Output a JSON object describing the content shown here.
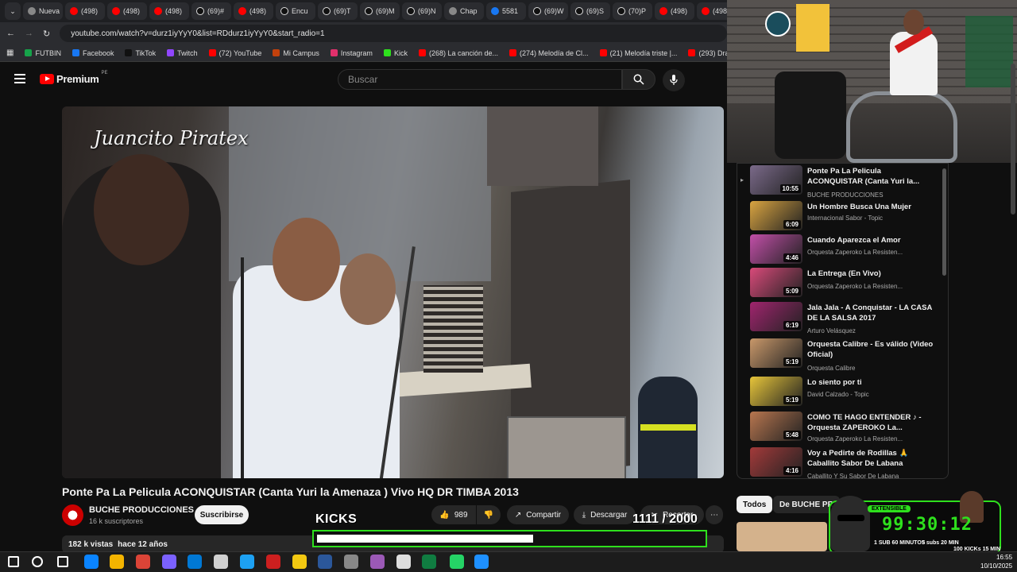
{
  "browser": {
    "tabs": [
      {
        "label": "Nueva",
        "icon": "gl"
      },
      {
        "label": "(498)",
        "icon": "yt"
      },
      {
        "label": "(498)",
        "icon": "yt"
      },
      {
        "label": "(498)",
        "icon": "yt"
      },
      {
        "label": "(69)#",
        "icon": "tk"
      },
      {
        "label": "(498)",
        "icon": "yt"
      },
      {
        "label": "Encu",
        "icon": "tk"
      },
      {
        "label": "(69)T",
        "icon": "tk"
      },
      {
        "label": "(69)M",
        "icon": "tk"
      },
      {
        "label": "(69)N",
        "icon": "tk"
      },
      {
        "label": "Chap",
        "icon": "gl"
      },
      {
        "label": "5581",
        "icon": "fb"
      },
      {
        "label": "(69)W",
        "icon": "tk"
      },
      {
        "label": "(69)S",
        "icon": "tk"
      },
      {
        "label": "(70)P",
        "icon": "tk"
      },
      {
        "label": "(498)",
        "icon": "yt"
      },
      {
        "label": "(498)",
        "icon": "yt"
      }
    ],
    "url": "youtube.com/watch?v=durz1iyYyY0&list=RDdurz1iyYyY0&start_radio=1",
    "bookmarks": [
      {
        "label": "FUTBIN",
        "color": "#16a34a"
      },
      {
        "label": "Facebook",
        "color": "#1877f2"
      },
      {
        "label": "TikTok",
        "color": "#111111"
      },
      {
        "label": "Twitch",
        "color": "#9146ff"
      },
      {
        "label": "(72) YouTube",
        "color": "#ff0000"
      },
      {
        "label": "Mi Campus",
        "color": "#c2410c"
      },
      {
        "label": "Instagram",
        "color": "#e1306c"
      },
      {
        "label": "Kick",
        "color": "#2ee01d"
      },
      {
        "label": "(268) La canción de...",
        "color": "#ff0000"
      },
      {
        "label": "(274) Melodía de Cl...",
        "color": "#ff0000"
      },
      {
        "label": "(21) Melodía triste |...",
        "color": "#ff0000"
      },
      {
        "label": "(293) Dragon Ball E...",
        "color": "#ff0000"
      }
    ]
  },
  "youtube": {
    "logo": "Premium",
    "region": "PE",
    "search_placeholder": "Buscar",
    "video_overlay_text": "Juancito Piratex",
    "video_title": "Ponte Pa La Pelicula ACONQUISTAR (Canta Yuri la Amenaza ) Vivo HQ DR TIMBA 2013",
    "channel": "BUCHE PRODUCCIONES",
    "subscribers": "16 k suscriptores",
    "subscribe_label": "Suscribirse",
    "likes": "989",
    "share_label": "Compartir",
    "download_label": "Descargar",
    "clip_label": "Recortar",
    "views": "182 k vistas",
    "age": "hace 12 años"
  },
  "playlist": [
    {
      "title": "Ponte Pa La Pelicula ACONQUISTAR (Canta Yuri la...",
      "channel": "BUCHE PRODUCCIONES",
      "duration": "10:55",
      "color": "#7b6a8a"
    },
    {
      "title": "Un Hombre Busca Una Mujer",
      "channel": "Internacional Sabor - Topic",
      "duration": "6:09",
      "color": "#d9a441"
    },
    {
      "title": "Cuando Aparezca el Amor",
      "channel": "Orquesta Zaperoko La Resisten...",
      "duration": "4:46",
      "color": "#c24fa8"
    },
    {
      "title": "La Entrega (En Vivo)",
      "channel": "Orquesta Zaperoko La Resisten...",
      "duration": "5:09",
      "color": "#d94a7a"
    },
    {
      "title": "Jala Jala - A Conquistar - LA CASA DE LA SALSA 2017",
      "channel": "Arturo Velásquez",
      "duration": "6:19",
      "color": "#a0246e"
    },
    {
      "title": "Orquesta Calibre - Es válido (Video Oficial)",
      "channel": "Orquesta Calibre",
      "duration": "5:19",
      "color": "#c9986a"
    },
    {
      "title": "Lo siento por ti",
      "channel": "David Calzado - Topic",
      "duration": "5:19",
      "color": "#e7c53a"
    },
    {
      "title": "COMO TE HAGO ENTENDER ♪ - Orquesta ZAPEROKO La...",
      "channel": "Orquesta Zaperoko La Resisten...",
      "duration": "5:48",
      "color": "#b8764f"
    },
    {
      "title": "Voy a Pedirte de Rodillas 🙏 Caballito Sabor De Labana",
      "channel": "Caballito Y Su Sabor De Labana",
      "duration": "4:16",
      "color": "#a33a3a"
    }
  ],
  "chips": {
    "all": "Todos",
    "channel": "De BUCHE PR"
  },
  "overlay": {
    "kicks_label": "KICKS",
    "kicks_count": "1111 / 2000",
    "kicks_progress": 0.5555,
    "timer_tag": "EXTENSIBLE",
    "timer": "99:30:12",
    "timer_notes": [
      "1 SUB 60 MINUTOS",
      "5 subs 20 MIN",
      "100 KICKs 15 MIN"
    ]
  },
  "taskbar": {
    "time": "16:55",
    "date": "10/10/2025"
  }
}
